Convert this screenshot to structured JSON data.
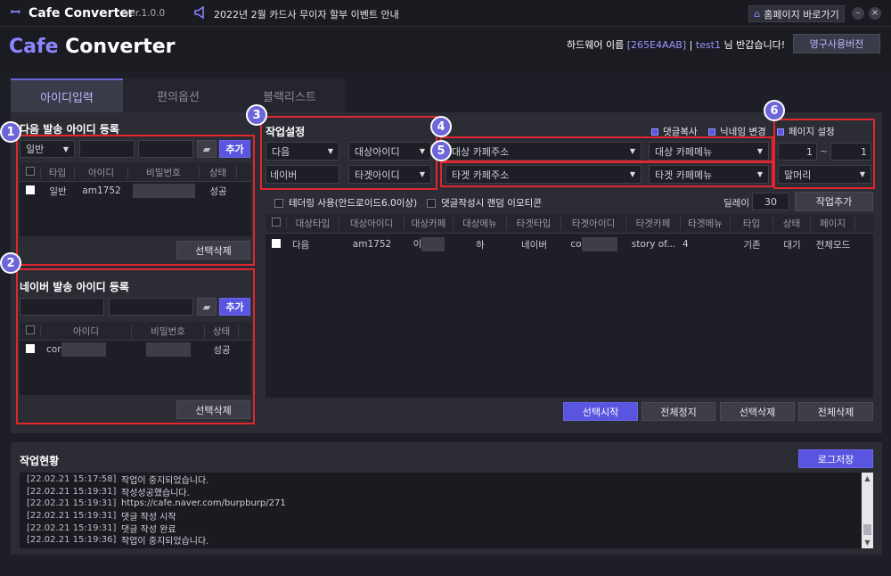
{
  "titlebar": {
    "app_name": "Cafe Converter",
    "version": "Ver.1.0.0",
    "notice": "2022년 2월 카드사 무이자 할부 이벤트 안내",
    "homepage_button": "홈페이지 바로가기"
  },
  "header": {
    "logo_cafe": "Cafe",
    "logo_converter": "Converter",
    "hw_label": "하드웨어 이름",
    "hw_id": "[265E4AAB]",
    "separator": "|",
    "user": "test1",
    "greeting": "님 반갑습니다!",
    "license_button": "영구사용버전"
  },
  "tabs": [
    "아이디입력",
    "편의옵션",
    "블랙리스트"
  ],
  "daum_section": {
    "title": "다음 발송 아이디 등록",
    "type_select": "일반",
    "add_button": "추가",
    "columns": [
      "타입",
      "아이디",
      "비밀번호",
      "상태"
    ],
    "rows": [
      {
        "type": "일반",
        "id": "am1752",
        "status": "성공"
      }
    ],
    "delete_button": "선택삭제"
  },
  "naver_section": {
    "title": "네이버 발송 아이디 등록",
    "add_button": "추가",
    "columns": [
      "아이디",
      "비밀번호",
      "상태"
    ],
    "rows": [
      {
        "id": "cor",
        "status": "성공"
      }
    ],
    "delete_button": "선택삭제"
  },
  "work_settings": {
    "title": "작업설정",
    "source_platform": "다음",
    "source_id": "대상아이디",
    "target_platform": "네이버",
    "target_id": "타겟아이디",
    "source_cafe_url": "대상 카페주소",
    "source_cafe_menu": "대상 카페메뉴",
    "target_cafe_url": "타겟 카페주소",
    "target_cafe_menu": "타겟 카페메뉴",
    "copy_comments": "댓글복사",
    "change_nickname": "닉네임 변경",
    "page_setting": "페이지 설정",
    "page_from": "1",
    "page_sep": "~",
    "page_to": "1",
    "header_select": "말머리",
    "tethering": "테더링 사용(안드로이드6.0이상)",
    "random_emoticon": "댓글작성시 랜덤 이모티콘",
    "delay_label": "딜레이",
    "delay_value": "30",
    "add_job_button": "작업추가"
  },
  "job_table": {
    "columns": [
      "대상타입",
      "대상아이디",
      "대상카페",
      "대상메뉴",
      "타겟타입",
      "타겟아이디",
      "타겟카페",
      "타겟메뉴",
      "타입",
      "상태",
      "페이지"
    ],
    "rows": [
      {
        "src_type": "다음",
        "src_id": "am1752",
        "src_cafe": "이",
        "src_menu": "하",
        "tgt_type": "네이버",
        "tgt_id": "co",
        "tgt_cafe": "story of...",
        "tgt_menu": "4",
        "type": "기존",
        "status": "대기",
        "page": "전체모드"
      }
    ]
  },
  "actions": {
    "start": "선택시작",
    "stop_all": "전체정지",
    "delete_selected": "선택삭제",
    "delete_all": "전체삭제"
  },
  "log": {
    "title": "작업현황",
    "save_button": "로그저장",
    "lines": [
      {
        "time": "[22.02.21 15:17:58]",
        "msg": "작업이 중지되었습니다."
      },
      {
        "time": "[22.02.21 15:19:31]",
        "msg": "작성성공했습니다."
      },
      {
        "time": "[22.02.21 15:19:31]",
        "msg": "https://cafe.naver.com/burpburp/271"
      },
      {
        "time": "[22.02.21 15:19:31]",
        "msg": "댓글 작성 시작"
      },
      {
        "time": "[22.02.21 15:19:31]",
        "msg": "댓글 작성 완료"
      },
      {
        "time": "[22.02.21 15:19:36]",
        "msg": "작업이 중지되었습니다."
      }
    ]
  },
  "markers": [
    "1",
    "2",
    "3",
    "4",
    "5",
    "6"
  ],
  "colors": {
    "accent": "#5a55e0",
    "highlight": "#e0262f",
    "marker": "#6c66d8"
  }
}
